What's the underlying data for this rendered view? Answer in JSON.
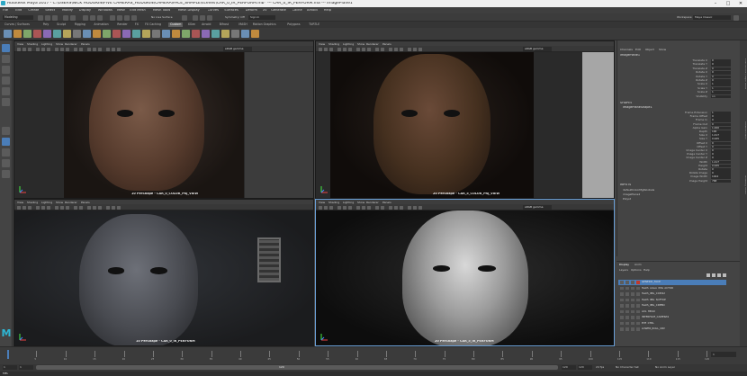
{
  "window": {
    "title": "Autodesk Maya 2017 - C:\\USERS\\NICK HODGKIN\\FIVE CAMERAS_HODGKIN\\CAMERA\\FACE_SAMPLE\\scenes\\CAR_0_IR_PERFORM.mb* --- CAR_0_IR_PERFORM.ma --- imagePlane1"
  },
  "menubar": {
    "items": [
      "File",
      "Edit",
      "Create",
      "Select",
      "Modify",
      "Display",
      "Windows",
      "Mesh",
      "Edit Mesh",
      "Mesh Tools",
      "Mesh Display",
      "Curves",
      "Surfaces",
      "Deform",
      "UV",
      "Generate",
      "Cache",
      "Arnold",
      "Help"
    ]
  },
  "statusline": {
    "mode": "Modeling",
    "no_live": "No Live Surface",
    "symmetry": "Symmetry: Off",
    "workspace_label": "Workspace:",
    "workspace": "Maya Classic",
    "sign_in": "Sign In"
  },
  "shelf": {
    "tabs": [
      "Curves / Surfaces",
      "Poly",
      "Sculpt",
      "Rigging",
      "Animation",
      "Render",
      "FX",
      "FX Caching",
      "Custom",
      "XGen",
      "Arnold",
      "Bifrost",
      "MASH",
      "Motion Graphics",
      "Polygons",
      "TURTLE"
    ],
    "active_index": 8
  },
  "viewport": {
    "menu": [
      "View",
      "Shading",
      "Lighting",
      "Show",
      "Renderer",
      "Panels"
    ],
    "gamma": "sRGB gamma",
    "panels": [
      {
        "camera": "10 PerShape - CAR_0_COLOR_PRJ_VIEW"
      },
      {
        "camera": "20 PerShape - CAR_5_COLOR_PRJ_VIEW"
      },
      {
        "camera": "10 PerShape - CAR_0_IR_PERFORM"
      },
      {
        "camera": "20 PerShape - CAR_5_IR_PERFORM"
      }
    ]
  },
  "attribute_editor": {
    "tabs": [
      "Channels",
      "Edit",
      "Object",
      "Show"
    ],
    "node_name": "imagePlane1",
    "channels": [
      {
        "label": "Translate X",
        "value": "0"
      },
      {
        "label": "Translate Y",
        "value": "0"
      },
      {
        "label": "Translate Z",
        "value": "0"
      },
      {
        "label": "Rotate X",
        "value": "0"
      },
      {
        "label": "Rotate Y",
        "value": "0"
      },
      {
        "label": "Rotate Z",
        "value": "0"
      },
      {
        "label": "Scale X",
        "value": "1"
      },
      {
        "label": "Scale Y",
        "value": "1"
      },
      {
        "label": "Scale Z",
        "value": "1"
      },
      {
        "label": "Visibility",
        "value": "on"
      }
    ],
    "shapes_header": "SHAPES",
    "shape_name": "imagePlaneShape1",
    "shape_attrs": [
      {
        "label": "Frame Extension",
        "value": "1"
      },
      {
        "label": "Frame Offset",
        "value": "0"
      },
      {
        "label": "Frame In",
        "value": "0"
      },
      {
        "label": "Frame Out",
        "value": "0"
      },
      {
        "label": "Alpha Gain",
        "value": "1.000"
      },
      {
        "label": "Depth",
        "value": "100"
      },
      {
        "label": "Size X",
        "value": "1.417"
      },
      {
        "label": "Size Y",
        "value": "0.945"
      },
      {
        "label": "Offset X",
        "value": "0"
      },
      {
        "label": "Offset Y",
        "value": "0"
      },
      {
        "label": "Image Center X",
        "value": "0"
      },
      {
        "label": "Image Center Y",
        "value": "0"
      },
      {
        "label": "Image Center Z",
        "value": "0"
      },
      {
        "label": "Width",
        "value": "1.417"
      },
      {
        "label": "Height",
        "value": "0.945"
      },
      {
        "label": "Rotate",
        "value": "0"
      },
      {
        "label": "Rotate Image",
        "value": "0"
      },
      {
        "label": "Image Width",
        "value": "1024"
      },
      {
        "label": "Image Height",
        "value": "768"
      }
    ],
    "inputs_header": "INPUTS",
    "inputs": [
      "defaultColorMgtGlobals",
      "imagePlane1",
      "Polyst"
    ]
  },
  "layers": {
    "tabs": [
      "Display",
      "Anim"
    ],
    "subtabs": [
      "Layers",
      "Options",
      "Help"
    ],
    "items": [
      "GENERIC_FACE",
      "Teeth_group_IMG_ACTOR",
      "Teeth_IMG_CCPOLY",
      "Teeth_IMG_SOFTUP",
      "Teeth_IMG_CDEBO",
      "AXL_HEAD",
      "INTERFACE_CAMERAS",
      "EYE_CTRL",
      "LOWER_ROLL_CRV"
    ]
  },
  "timeline": {
    "ticks": [
      "5",
      "10",
      "15",
      "20",
      "25",
      "30",
      "35",
      "40",
      "45",
      "50",
      "55",
      "60",
      "65",
      "70",
      "75",
      "80",
      "85",
      "90",
      "95",
      "100",
      "105",
      "110",
      "115",
      "120"
    ],
    "current_frame": "1",
    "start": "1",
    "end": "120",
    "range_start": "1",
    "range_end": "120",
    "range_label": "120",
    "char_set": "No Character Set",
    "anim_layer": "No Anim Layer",
    "fps": "24 fps"
  },
  "colors": {
    "accent": "#4a7db8",
    "selected_border": "#6aa0d8",
    "layer_red": "#c0392b"
  }
}
